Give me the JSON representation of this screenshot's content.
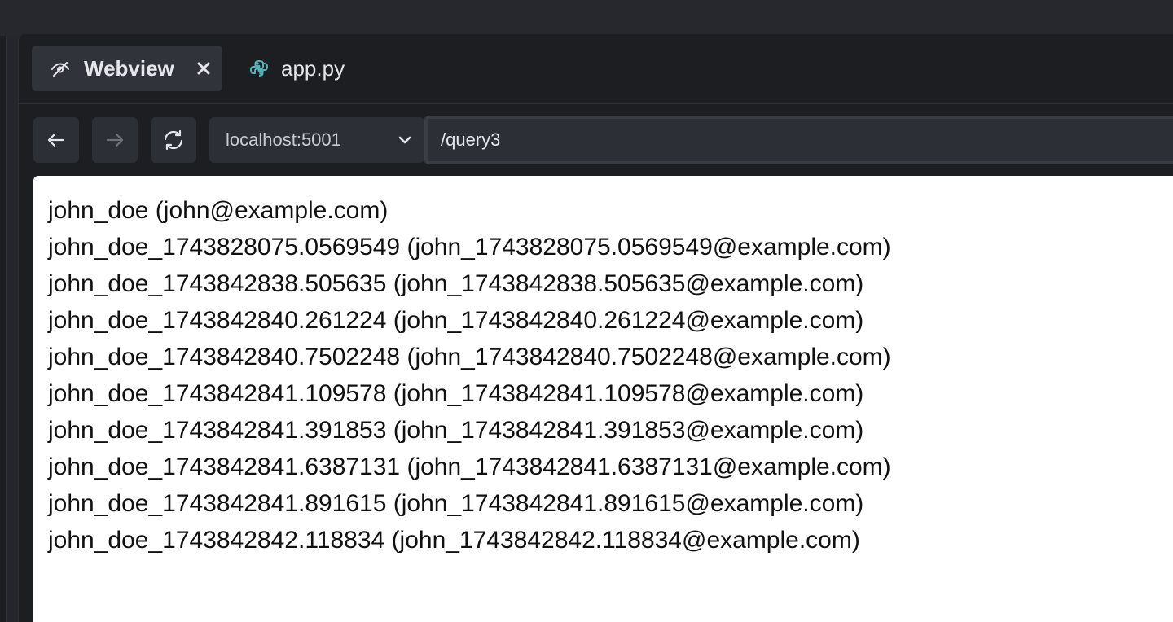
{
  "tabs": [
    {
      "label": "Webview",
      "icon": "webview-eye-icon",
      "active": true
    },
    {
      "label": "app.py",
      "icon": "python-icon",
      "active": false
    }
  ],
  "toolbar": {
    "back_icon": "arrow-left-icon",
    "forward_icon": "arrow-right-icon",
    "reload_icon": "reload-icon",
    "host": "localhost:5001",
    "path": "/query3"
  },
  "colors": {
    "python_icon": "#4fb3b8",
    "panel_bg": "#1c1e22",
    "tab_active_bg": "#30333a"
  },
  "results": [
    "john_doe (john@example.com)",
    "john_doe_1743828075.0569549 (john_1743828075.0569549@example.com)",
    "john_doe_1743842838.505635 (john_1743842838.505635@example.com)",
    "john_doe_1743842840.261224 (john_1743842840.261224@example.com)",
    "john_doe_1743842840.7502248 (john_1743842840.7502248@example.com)",
    "john_doe_1743842841.109578 (john_1743842841.109578@example.com)",
    "john_doe_1743842841.391853 (john_1743842841.391853@example.com)",
    "john_doe_1743842841.6387131 (john_1743842841.6387131@example.com)",
    "john_doe_1743842841.891615 (john_1743842841.891615@example.com)",
    "john_doe_1743842842.118834 (john_1743842842.118834@example.com)"
  ]
}
